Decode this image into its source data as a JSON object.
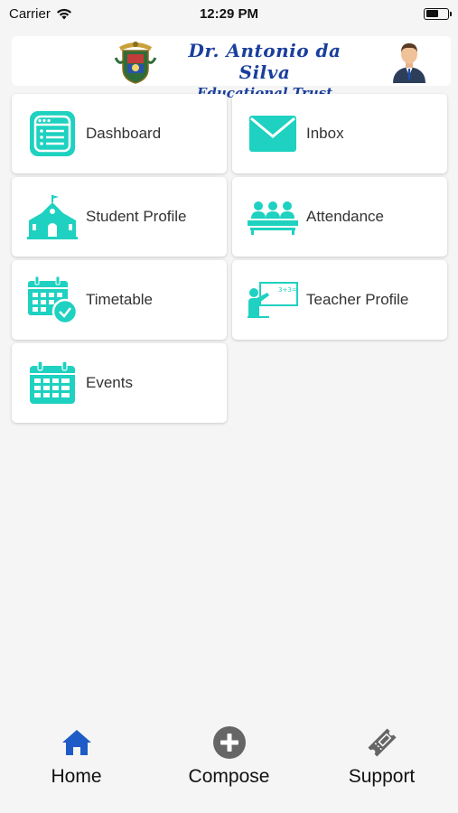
{
  "status_bar": {
    "carrier": "Carrier",
    "time": "12:29 PM",
    "battery_level": 0.6
  },
  "header": {
    "title_line1": "Dr. Antonio da Silva",
    "title_line2": "Educational Trust",
    "brand_color": "#1a3f9c",
    "crest_icon": "school-crest-icon",
    "avatar_icon": "user-avatar-icon"
  },
  "menu": {
    "accent_color": "#1ed1c0",
    "items": [
      {
        "label": "Dashboard",
        "icon": "dashboard-icon"
      },
      {
        "label": "Inbox",
        "icon": "envelope-icon"
      },
      {
        "label": "Student Profile",
        "icon": "school-building-icon"
      },
      {
        "label": "Attendance",
        "icon": "group-icon"
      },
      {
        "label": "Timetable",
        "icon": "calendar-clock-icon"
      },
      {
        "label": "Teacher Profile",
        "icon": "teacher-board-icon"
      },
      {
        "label": "Events",
        "icon": "calendar-icon"
      }
    ]
  },
  "tabbar": {
    "active_color": "#1e5bc6",
    "inactive_color": "#666666",
    "tabs": [
      {
        "label": "Home",
        "icon": "home-icon",
        "active": true
      },
      {
        "label": "Compose",
        "icon": "plus-circle-icon",
        "active": false
      },
      {
        "label": "Support",
        "icon": "ticket-icon",
        "active": false
      }
    ]
  }
}
